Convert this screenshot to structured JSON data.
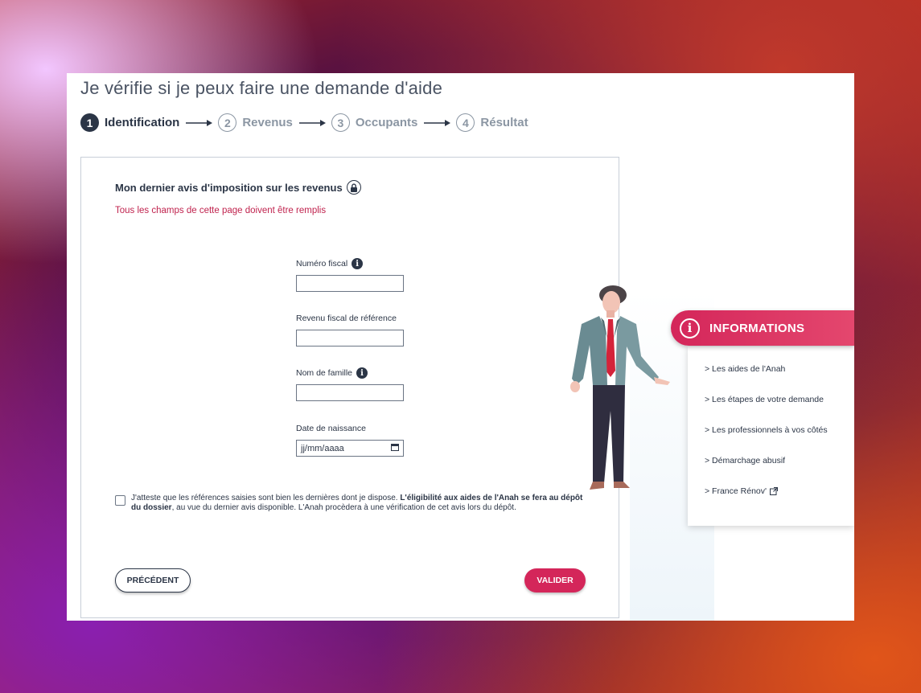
{
  "page": {
    "title": "Je vérifie si je peux faire une demande d'aide"
  },
  "stepper": [
    {
      "num": "1",
      "label": "Identification",
      "active": true
    },
    {
      "num": "2",
      "label": "Revenus",
      "active": false
    },
    {
      "num": "3",
      "label": "Occupants",
      "active": false
    },
    {
      "num": "4",
      "label": "Résultat",
      "active": false
    }
  ],
  "form": {
    "section_title": "Mon dernier avis d'imposition sur les revenus",
    "required_note": "Tous les champs de cette page doivent être remplis",
    "fields": {
      "numero_fiscal": {
        "label": "Numéro fiscal",
        "value": ""
      },
      "revenu_fiscal": {
        "label": "Revenu fiscal de référence",
        "value": ""
      },
      "nom_famille": {
        "label": "Nom de famille",
        "value": ""
      },
      "date_naissance": {
        "label": "Date de naissance",
        "placeholder": "jj/mm/aaaa"
      }
    },
    "attest": {
      "text_start": "J'atteste que les références saisies sont bien les dernières dont je dispose. ",
      "text_bold": "L'éligibilité aux aides de l'Anah se fera au dépôt du dossier",
      "text_end": ", au vue du dernier avis disponible. L'Anah procèdera à une vérification de cet avis lors du dépôt.",
      "checked": false
    },
    "buttons": {
      "prev": "PRÉCÉDENT",
      "submit": "VALIDER"
    }
  },
  "info_panel": {
    "title": "INFORMATIONS",
    "links": [
      "> Les aides de l'Anah",
      "> Les étapes de votre demande",
      "> Les professionnels à vos côtés",
      "> Démarchage abusif",
      "> France Rénov'"
    ]
  },
  "colors": {
    "accent": "#d4265a",
    "text_dark": "#2b3546",
    "muted": "#8b96a3"
  }
}
